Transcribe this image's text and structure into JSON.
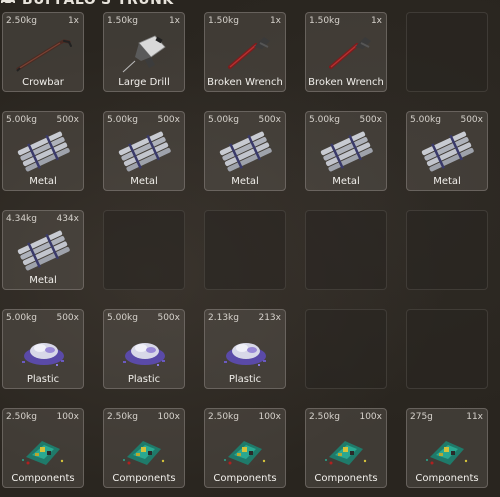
{
  "header": {
    "title": "BUFFALO'S TRUNK"
  },
  "rows": [
    [
      {
        "weight": "2.50kg",
        "qty": "1x",
        "name": "Crowbar",
        "icon": "crowbar-icon"
      },
      {
        "weight": "1.50kg",
        "qty": "1x",
        "name": "Large Drill",
        "icon": "drill-icon"
      },
      {
        "weight": "1.50kg",
        "qty": "1x",
        "name": "Broken Wrench",
        "icon": "wrench-icon"
      },
      {
        "weight": "1.50kg",
        "qty": "1x",
        "name": "Broken Wrench",
        "icon": "wrench-icon"
      },
      null
    ],
    [
      {
        "weight": "5.00kg",
        "qty": "500x",
        "name": "Metal",
        "icon": "metal-bars-icon"
      },
      {
        "weight": "5.00kg",
        "qty": "500x",
        "name": "Metal",
        "icon": "metal-bars-icon"
      },
      {
        "weight": "5.00kg",
        "qty": "500x",
        "name": "Metal",
        "icon": "metal-bars-icon"
      },
      {
        "weight": "5.00kg",
        "qty": "500x",
        "name": "Metal",
        "icon": "metal-bars-icon"
      },
      {
        "weight": "5.00kg",
        "qty": "500x",
        "name": "Metal",
        "icon": "metal-bars-icon"
      }
    ],
    [
      {
        "weight": "4.34kg",
        "qty": "434x",
        "name": "Metal",
        "icon": "metal-bars-icon"
      },
      null,
      null,
      null,
      null
    ],
    [
      {
        "weight": "5.00kg",
        "qty": "500x",
        "name": "Plastic",
        "icon": "plastic-pile-icon"
      },
      {
        "weight": "5.00kg",
        "qty": "500x",
        "name": "Plastic",
        "icon": "plastic-pile-icon"
      },
      {
        "weight": "2.13kg",
        "qty": "213x",
        "name": "Plastic",
        "icon": "plastic-pile-icon"
      },
      null,
      null
    ],
    [
      {
        "weight": "2.50kg",
        "qty": "100x",
        "name": "Components",
        "icon": "components-icon"
      },
      {
        "weight": "2.50kg",
        "qty": "100x",
        "name": "Components",
        "icon": "components-icon"
      },
      {
        "weight": "2.50kg",
        "qty": "100x",
        "name": "Components",
        "icon": "components-icon"
      },
      {
        "weight": "2.50kg",
        "qty": "100x",
        "name": "Components",
        "icon": "components-icon"
      },
      {
        "weight": "275g",
        "qty": "11x",
        "name": "Components",
        "icon": "components-icon"
      }
    ]
  ],
  "colors": {
    "background": "#29251f",
    "slot_filled": "#69645f",
    "slot_border": "#96918c",
    "text": "#f2f0ec"
  }
}
